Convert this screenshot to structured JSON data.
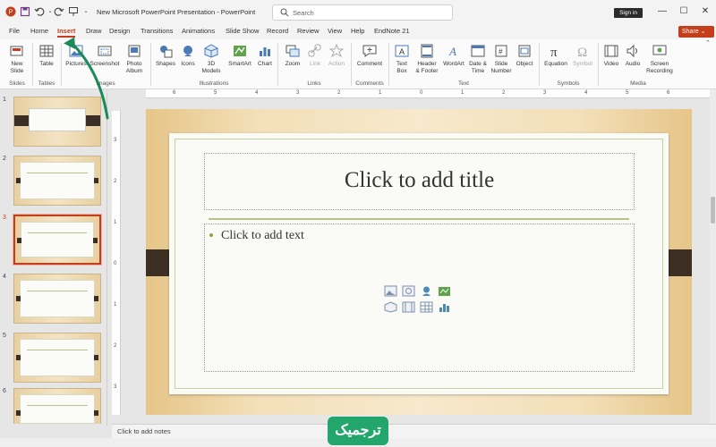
{
  "titlebar": {
    "doc_title": "New Microsoft PowerPoint Presentation  -  PowerPoint",
    "search_placeholder": "Search",
    "signin_label": "Sign in"
  },
  "tabs": [
    {
      "label": "File"
    },
    {
      "label": "Home"
    },
    {
      "label": "Insert",
      "active": true
    },
    {
      "label": "Draw"
    },
    {
      "label": "Design"
    },
    {
      "label": "Transitions"
    },
    {
      "label": "Animations"
    },
    {
      "label": "Slide Show"
    },
    {
      "label": "Record"
    },
    {
      "label": "Review"
    },
    {
      "label": "View"
    },
    {
      "label": "Help"
    },
    {
      "label": "EndNote 21"
    }
  ],
  "share_label": "Share",
  "ribbon": {
    "buttons": [
      {
        "label": "New\nSlide",
        "icon": "new-slide-icon"
      },
      {
        "label": "Table",
        "icon": "table-icon"
      },
      {
        "label": "Pictures",
        "icon": "pictures-icon"
      },
      {
        "label": "Screenshot",
        "icon": "screenshot-icon"
      },
      {
        "label": "Photo\nAlbum",
        "icon": "photo-album-icon"
      },
      {
        "label": "Shapes",
        "icon": "shapes-icon"
      },
      {
        "label": "Icons",
        "icon": "icons-icon"
      },
      {
        "label": "3D\nModels",
        "icon": "3d-models-icon"
      },
      {
        "label": "SmartArt",
        "icon": "smartart-icon"
      },
      {
        "label": "Chart",
        "icon": "chart-icon"
      },
      {
        "label": "Zoom",
        "icon": "zoom-icon"
      },
      {
        "label": "Link",
        "icon": "link-icon",
        "disabled": true
      },
      {
        "label": "Action",
        "icon": "action-icon",
        "disabled": true
      },
      {
        "label": "Comment",
        "icon": "comment-icon"
      },
      {
        "label": "Text\nBox",
        "icon": "text-box-icon"
      },
      {
        "label": "Header\n& Footer",
        "icon": "header-footer-icon"
      },
      {
        "label": "WordArt",
        "icon": "wordart-icon"
      },
      {
        "label": "Date &\nTime",
        "icon": "date-time-icon"
      },
      {
        "label": "Slide\nNumber",
        "icon": "slide-number-icon"
      },
      {
        "label": "Object",
        "icon": "object-icon"
      },
      {
        "label": "Equation",
        "icon": "equation-icon"
      },
      {
        "label": "Symbol",
        "icon": "symbol-icon",
        "disabled": true
      },
      {
        "label": "Video",
        "icon": "video-icon"
      },
      {
        "label": "Audio",
        "icon": "audio-icon"
      },
      {
        "label": "Screen\nRecording",
        "icon": "screen-recording-icon"
      }
    ],
    "groups": [
      {
        "label": "Slides"
      },
      {
        "label": "Tables"
      },
      {
        "label": "Images"
      },
      {
        "label": "Illustrations"
      },
      {
        "label": "Links"
      },
      {
        "label": "Comments"
      },
      {
        "label": "Text"
      },
      {
        "label": "Symbols"
      },
      {
        "label": "Media"
      }
    ]
  },
  "ruler": {
    "h_ticks": [
      "6",
      "5",
      "4",
      "3",
      "2",
      "1",
      "0",
      "1",
      "2",
      "3",
      "4",
      "5",
      "6"
    ],
    "v_ticks": [
      "3",
      "2",
      "1",
      "0",
      "1",
      "2",
      "3"
    ]
  },
  "thumbnails": [
    {
      "number": "1"
    },
    {
      "number": "2"
    },
    {
      "number": "3",
      "active": true
    },
    {
      "number": "4"
    },
    {
      "number": "5"
    },
    {
      "number": "6"
    }
  ],
  "slide": {
    "title_placeholder": "Click to add title",
    "body_placeholder": "Click to add text"
  },
  "notes_placeholder": "Click to add notes",
  "watermark_text": "ترجمیک",
  "colors": {
    "accent": "#c43e1c",
    "annotation_arrow": "#1b8a57",
    "watermark_bg": "#22a66b"
  }
}
